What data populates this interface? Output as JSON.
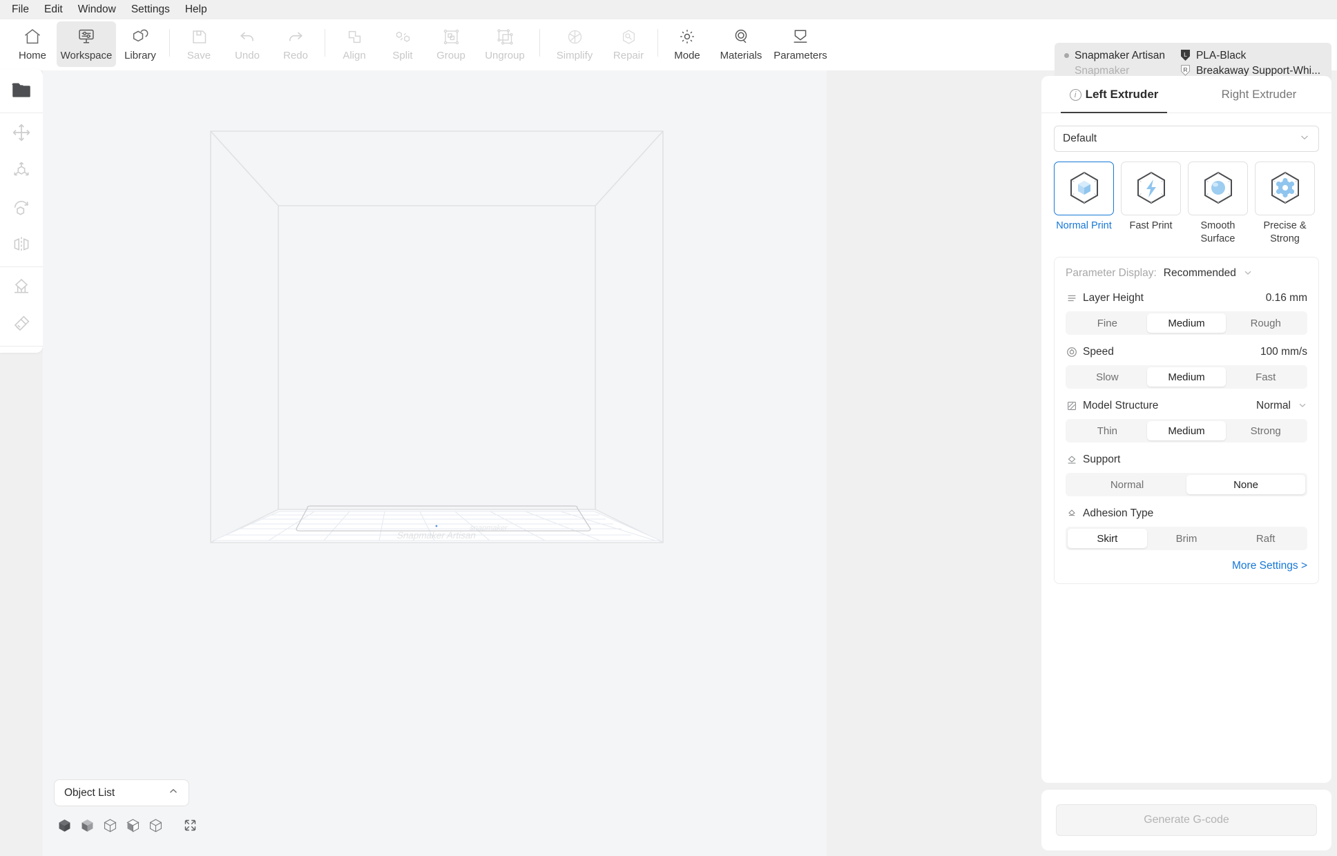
{
  "menubar": {
    "items": [
      {
        "label": "File"
      },
      {
        "label": "Edit"
      },
      {
        "label": "Window"
      },
      {
        "label": "Settings"
      },
      {
        "label": "Help"
      }
    ]
  },
  "toolbar": {
    "items": [
      {
        "label": "Home",
        "icon": "home-icon",
        "state": "enabled"
      },
      {
        "label": "Workspace",
        "icon": "workspace-icon",
        "state": "active"
      },
      {
        "label": "Library",
        "icon": "library-icon",
        "state": "enabled"
      },
      {
        "label": "Save",
        "icon": "save-icon",
        "state": "disabled"
      },
      {
        "label": "Undo",
        "icon": "undo-icon",
        "state": "disabled"
      },
      {
        "label": "Redo",
        "icon": "redo-icon",
        "state": "disabled"
      },
      {
        "label": "Align",
        "icon": "align-icon",
        "state": "disabled"
      },
      {
        "label": "Split",
        "icon": "split-icon",
        "state": "disabled"
      },
      {
        "label": "Group",
        "icon": "group-icon",
        "state": "disabled"
      },
      {
        "label": "Ungroup",
        "icon": "ungroup-icon",
        "state": "disabled"
      },
      {
        "label": "Simplify",
        "icon": "simplify-icon",
        "state": "disabled"
      },
      {
        "label": "Repair",
        "icon": "repair-icon",
        "state": "disabled"
      },
      {
        "label": "Mode",
        "icon": "mode-gear-icon",
        "state": "enabled"
      },
      {
        "label": "Materials",
        "icon": "materials-icon",
        "state": "enabled"
      },
      {
        "label": "Parameters",
        "icon": "parameters-icon",
        "state": "enabled"
      }
    ]
  },
  "machine_info": {
    "machine_name": "Snapmaker Artisan",
    "machine_brand": "Snapmaker",
    "left_material": "PLA-Black",
    "left_badge": "L",
    "right_material": "Breakaway Support-Whi...",
    "right_badge": "R"
  },
  "left_tools": [
    {
      "name": "open-file-tool",
      "icon": "folder-icon",
      "active": true
    },
    {
      "name": "move-tool",
      "icon": "move-arrows-icon",
      "active": false
    },
    {
      "name": "scale-tool",
      "icon": "scale-axes-icon",
      "active": false
    },
    {
      "name": "rotate-tool",
      "icon": "rotate-cube-icon",
      "active": false
    },
    {
      "name": "mirror-tool",
      "icon": "mirror-icon",
      "active": false
    },
    {
      "name": "support-tool",
      "icon": "support-icon",
      "active": false
    },
    {
      "name": "brush-tool",
      "icon": "brush-icon",
      "active": false
    }
  ],
  "canvas": {
    "plate_label_primary": "Snapmaker Artisan",
    "plate_label_secondary": "snapmaker"
  },
  "object_list": {
    "title": "Object List",
    "collapse_icon": "chevron-up-icon",
    "view_buttons": [
      {
        "name": "view-isometric",
        "icon": "cube-iso-icon"
      },
      {
        "name": "view-front",
        "icon": "cube-front-icon"
      },
      {
        "name": "view-top",
        "icon": "cube-top-icon"
      },
      {
        "name": "view-left",
        "icon": "cube-left-icon"
      },
      {
        "name": "view-right",
        "icon": "cube-right-icon"
      },
      {
        "name": "fit-to-screen",
        "icon": "fit-screen-icon"
      }
    ]
  },
  "right_panel": {
    "tabs": [
      {
        "label": "Left Extruder",
        "active": true,
        "icon": "info-icon"
      },
      {
        "label": "Right Extruder",
        "active": false
      }
    ],
    "profile": {
      "value": "Default",
      "icon": "chevron-down-icon"
    },
    "presets": [
      {
        "label": "Normal\nPrint",
        "icon": "cube-icon",
        "selected": true
      },
      {
        "label": "Fast Print",
        "icon": "lightning-icon",
        "selected": false
      },
      {
        "label": "Smooth\nSurface",
        "icon": "sphere-icon",
        "selected": false
      },
      {
        "label": "Precise &\nStrong",
        "icon": "gear-icon",
        "selected": false
      }
    ],
    "parameter_display": {
      "label": "Parameter Display:",
      "value": "Recommended",
      "icon": "chevron-down-icon"
    },
    "settings": [
      {
        "name": "layer-height",
        "label": "Layer Height",
        "icon": "layers-icon",
        "value": "0.16 mm",
        "options": [
          "Fine",
          "Medium",
          "Rough"
        ],
        "selected": "Medium"
      },
      {
        "name": "speed",
        "label": "Speed",
        "icon": "speedometer-icon",
        "value": "100 mm/s",
        "options": [
          "Slow",
          "Medium",
          "Fast"
        ],
        "selected": "Medium"
      },
      {
        "name": "model-structure",
        "label": "Model Structure",
        "icon": "hatch-square-icon",
        "dropdown_value": "Normal",
        "dropdown_icon": "chevron-down-icon",
        "options": [
          "Thin",
          "Medium",
          "Strong"
        ],
        "selected": "Medium"
      },
      {
        "name": "support",
        "label": "Support",
        "icon": "diamond-icon",
        "options": [
          "Normal",
          "None"
        ],
        "selected": "None"
      },
      {
        "name": "adhesion-type",
        "label": "Adhesion Type",
        "icon": "adhesion-icon",
        "options": [
          "Skirt",
          "Brim",
          "Raft"
        ],
        "selected": "Skirt"
      }
    ],
    "more_settings": "More Settings >"
  },
  "footer": {
    "generate_gcode": "Generate G-code",
    "generate_gcode_enabled": false
  },
  "colors": {
    "accent_blue": "#1677d6",
    "canvas_bg": "#f4f5f6",
    "panel_bg": "#ffffff",
    "app_bg": "#f0f0f0",
    "disabled_text": "#c8c8c8"
  }
}
